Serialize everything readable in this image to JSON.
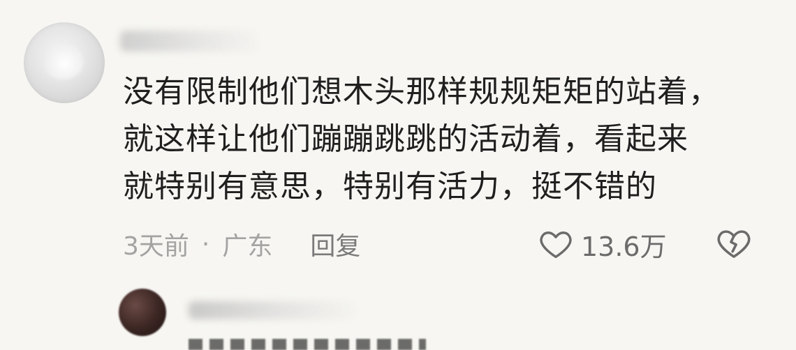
{
  "comment": {
    "text_lines": [
      "没有限制他们想木头那样规规矩矩的站着，",
      "就这样让他们蹦蹦跳跳的活动着，看起来",
      "就特别有意思，特别有活力，挺不错的"
    ],
    "time": "3天前",
    "separator": "·",
    "location": "广东",
    "reply_label": "回复",
    "like_count": "13.6万",
    "icons": {
      "like": "heart-outline-icon",
      "dislike": "broken-heart-icon"
    }
  },
  "colors": {
    "background": "#f7f6f2",
    "text_primary": "#1f1f1f",
    "text_secondary": "#a3a3a3",
    "icon": "#6b6b6b"
  }
}
